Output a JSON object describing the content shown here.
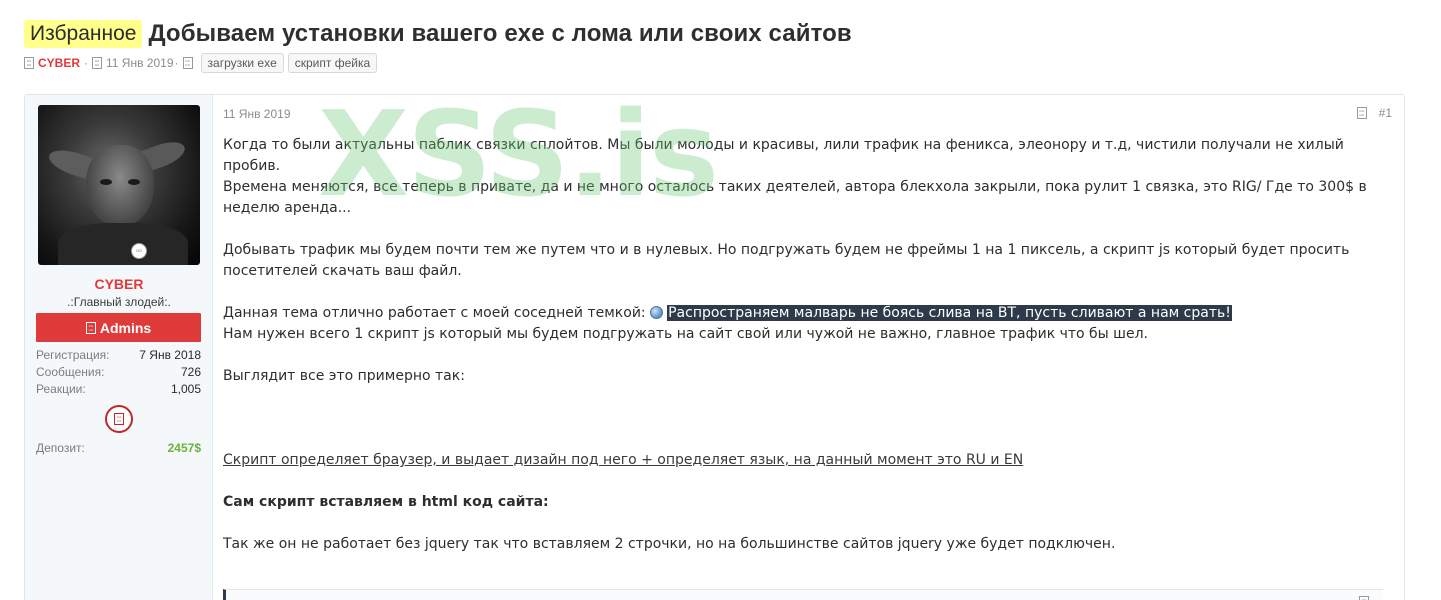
{
  "thread": {
    "prefix": "Избранное",
    "title": "Добываем установки вашего exe с лома или своих сайтов",
    "author": "CYBER",
    "separator": "·",
    "date": "11 Янв 2019",
    "tags": [
      "загрузки exe",
      "скрипт фейка"
    ]
  },
  "user": {
    "name": "CYBER",
    "title": ".:Главный злодей:.",
    "banner": "Admins",
    "stats": [
      {
        "label": "Регистрация:",
        "value": "7 Янв 2018"
      },
      {
        "label": "Сообщения:",
        "value": "726"
      },
      {
        "label": "Реакции:",
        "value": "1,005"
      }
    ],
    "deposit_label": "Депозит:",
    "deposit_value": "2457$"
  },
  "post": {
    "date": "11 Янв 2019",
    "number": "#1",
    "line1": "Когда то были актуальны паблик связки сплойтов. Мы были молоды и красивы, лили трафик на феникса, элеонору и т.д, чистили получали не хилый пробив.",
    "line2": "Времена меняются, все теперь в привате, да и не много осталось таких деятелей, автора блекхола закрыли, пока рулит 1 связка, это RIG/ Где то 300$ в неделю аренда...",
    "line3": "Добывать трафик мы будем почти тем же путем что и в нулевых. Но подгружать будем не фреймы 1 на 1 пиксель, а скрипт js который будет просить посетителей скачать ваш файл.",
    "line4_prefix": "Данная тема отлично работает с моей соседней темкой:",
    "line4_link": "Распространяем малварь не боясь слива на ВТ, пусть сливают а нам срать!",
    "line5": "Нам нужен всего 1 скрипт js который мы будем подгружать на сайт свой или чужой не важно, главное трафик что бы шел.",
    "line6": "Выглядит все это примерно так:",
    "line7": "Скрипт определяет браузер, и выдает дизайн под него + определяет язык, на данный момент это RU и EN",
    "line8": "Сам скрипт вставляем в html код сайта:",
    "line9": "Так же он не работает без jquery так что вставляем 2 строчки, но на большинстве сайтов jquery уже будет подключен."
  },
  "watermark": "XSS.is",
  "icons": {
    "author": "user-icon",
    "date": "clock-icon",
    "tag": "tag-icon",
    "banner": "shield-icon",
    "share": "share-icon",
    "link": "globe-icon",
    "award": "award-icon",
    "code_copy": "copy-icon"
  },
  "colors": {
    "accent_red": "#e03b3b",
    "prefix_bg": "#ffff8c",
    "deposit_green": "#6bb23a",
    "link_highlight_bg": "#2d3a4a"
  }
}
